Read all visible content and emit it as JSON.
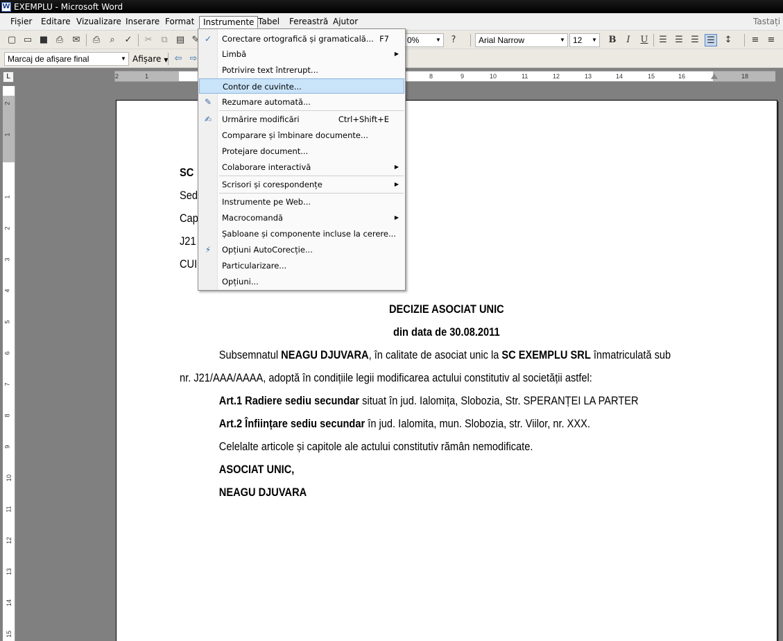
{
  "window": {
    "title": "EXEMPLU - Microsoft Word",
    "app_icon": "W"
  },
  "menubar": {
    "items": [
      "Fișier",
      "Editare",
      "Vizualizare",
      "Inserare",
      "Format",
      "Instrumente",
      "Tabel",
      "Fereastră",
      "Ajutor"
    ],
    "active": "Instrumente",
    "ask_placeholder": "Tastați o"
  },
  "toolbar": {
    "zoom": "0%",
    "font_name": "Arial Narrow",
    "font_size": "12",
    "bold": "B",
    "italic": "I",
    "underline": "U"
  },
  "review_toolbar": {
    "markup_mode": "Marcaj de afișare final",
    "show_label": "Afișare"
  },
  "ruler": {
    "h_numbers": [
      "2",
      "1",
      "8",
      "9",
      "10",
      "11",
      "12",
      "13",
      "14",
      "15",
      "16",
      "18"
    ],
    "v_numbers": [
      "2",
      "1",
      "1",
      "2",
      "3",
      "4",
      "5",
      "6",
      "7",
      "8",
      "9",
      "10",
      "11",
      "12",
      "13",
      "14",
      "15"
    ]
  },
  "tools_menu": {
    "items": [
      {
        "label": "Corectare ortografică și gramaticală...",
        "shortcut": "F7",
        "icon": "spellcheck-icon"
      },
      {
        "label": "Limbă",
        "submenu": true
      },
      {
        "label": "Potrivire text întrerupt..."
      },
      {
        "label": "Contor de cuvinte...",
        "highlighted": true
      },
      {
        "label": "Rezumare automată...",
        "icon": "autosummarize-icon"
      },
      {
        "label": "Urmărire modificări",
        "shortcut": "Ctrl+Shift+E",
        "icon": "track-changes-icon"
      },
      {
        "label": "Comparare și îmbinare documente..."
      },
      {
        "label": "Protejare document..."
      },
      {
        "label": "Colaborare interactivă",
        "submenu": true
      },
      {
        "label": "Scrisori și corespondențe",
        "submenu": true
      },
      {
        "label": "Instrumente pe Web..."
      },
      {
        "label": "Macrocomandă",
        "submenu": true
      },
      {
        "label": "Șabloane și componente incluse la cerere..."
      },
      {
        "label": "Opțiuni AutoCorecție...",
        "icon": "autocorrect-icon"
      },
      {
        "label": "Particularizare..."
      },
      {
        "label": "Opțiuni..."
      }
    ]
  },
  "document": {
    "header_lines": [
      "SC",
      "Sed",
      "Cap",
      "J21",
      "CUI"
    ],
    "title": "DECIZIE ASOCIAT UNIC",
    "date_line": "din data de 30.08.2011",
    "para1_a": "Subsemnatul ",
    "para1_name": "NEAGU DJUVARA",
    "para1_b": ", în calitate de asociat unic la ",
    "para1_company": "SC EXEMPLU SRL",
    "para1_c": " înmatriculată sub",
    "para2": "nr. J21/AAA/AAAA, adoptă în condițiile legii modificarea  actului constitutiv al societății astfel:",
    "art1_label": "Art.1 Radiere sediu secundar",
    "art1_text": " situat în jud. Ialomița, Slobozia, Str. SPERANȚEI LA PARTER",
    "art2_label": "Art.2 Înființare sediu secundar",
    "art2_text": " în jud. Ialomita, mun. Slobozia, str. Viilor, nr. XXX.",
    "closing": "Celelalte articole și capitole ale actului constitutiv rămân nemodificate.",
    "signature_role": "ASOCIAT UNIC,",
    "signature_name": "NEAGU DJUVARA"
  }
}
